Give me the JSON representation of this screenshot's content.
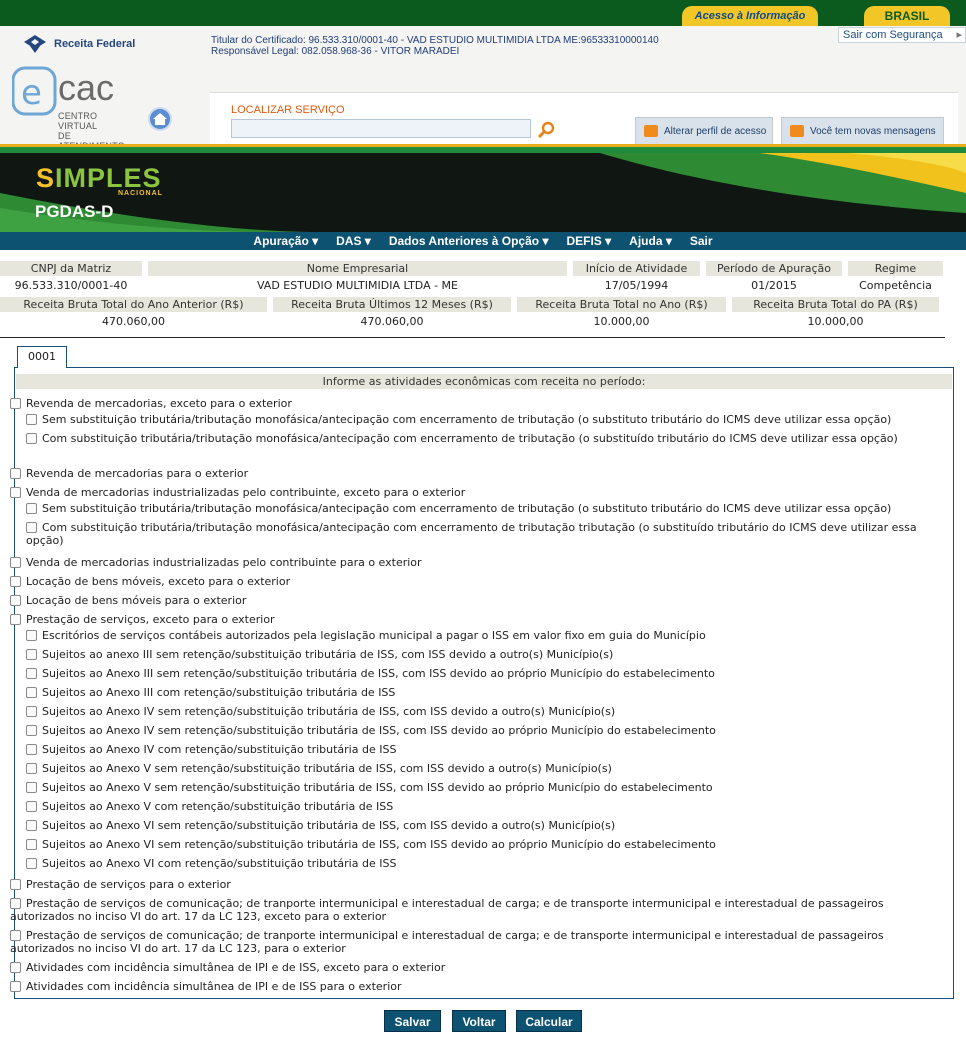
{
  "gov_bar": {
    "acesso": "Acesso à Informação",
    "brasil": "BRASIL"
  },
  "header": {
    "receita": "Receita Federal",
    "titular": "Titular do Certificado: 96.533.310/0001-40 - VAD ESTUDIO MULTIMIDIA LTDA ME:96533310000140",
    "responsavel": "Responsável Legal: 082.058.968-36 - VITOR MARADEI",
    "sair": "Sair com Segurança",
    "ecac": "cac",
    "ecac_sub1": "CENTRO VIRTUAL",
    "ecac_sub2": "DE ATENDIMENTO",
    "search_label": "LOCALIZAR SERVIÇO",
    "search_value": "",
    "perfil": "Alterar perfil de acesso",
    "mensagens": "Você tem novas mensagens"
  },
  "banner": {
    "logo_s": "S",
    "logo_rest": "IMPLES",
    "nacional": "NACIONAL",
    "title": "PGDAS-D"
  },
  "nav": [
    "Apuração ▾",
    "DAS ▾",
    "Dados Anteriores à Opção ▾",
    "DEFIS ▾",
    "Ajuda ▾",
    "Sair"
  ],
  "info": {
    "row1_headers": [
      "CNPJ da Matriz",
      "Nome Empresarial",
      "Início de Atividade",
      "Período de Apuração",
      "Regime"
    ],
    "row1_values": [
      "96.533.310/0001-40",
      "VAD ESTUDIO MULTIMIDIA LTDA - ME",
      "17/05/1994",
      "01/2015",
      "Competência"
    ],
    "row2_headers": [
      "Receita Bruta Total do Ano Anterior (R$)",
      "Receita Bruta Últimos 12 Meses (R$)",
      "Receita Bruta Total no Ano (R$)",
      "Receita Bruta Total do PA (R$)"
    ],
    "row2_values": [
      "470.060,00",
      "470.060,00",
      "10.000,00",
      "10.000,00"
    ]
  },
  "tab": "0001",
  "panel_title": "Informe as atividades econômicas com receita no período:",
  "activities": [
    "Revenda de mercadorias, exceto para o exterior",
    "Sem substituição tributária/tributação monofásica/antecipação com encerramento de tributação (o substituto tributário do ICMS deve utilizar essa opção)",
    "Com substituição tributária/tributação monofásica/antecipação com encerramento de tributação (o substituído tributário do ICMS deve utilizar essa opção)",
    "Revenda de mercadorias para o exterior",
    "Venda de mercadorias industrializadas pelo contribuinte, exceto para o exterior",
    "Sem substituição tributária/tributação monofásica/antecipação com encerramento de tributação (o substituto tributário do ICMS deve utilizar essa opção)",
    "Com substituição tributária/tributação monofásica/antecipação com encerramento de tributação tributação (o substituído tributário do ICMS deve utilizar essa opção)",
    "Venda de mercadorias industrializadas pelo contribuinte para o exterior",
    "Locação de bens móveis, exceto para o exterior",
    "Locação de bens móveis para o exterior",
    "Prestação de serviços, exceto para o exterior",
    "Escritórios de serviços contábeis autorizados pela legislação municipal a pagar o ISS em valor fixo em guia do Município",
    "Sujeitos ao anexo III sem retenção/substituição tributária de ISS, com ISS devido a outro(s) Município(s)",
    "Sujeitos ao Anexo III sem retenção/substituição tributária de ISS, com ISS devido ao próprio Município do estabelecimento",
    "Sujeitos ao Anexo III com retenção/substituição tributária de ISS",
    "Sujeitos ao Anexo IV sem retenção/substituição tributária de ISS, com ISS devido a outro(s) Município(s)",
    "Sujeitos ao Anexo IV sem retenção/substituição tributária de ISS, com ISS devido ao próprio Município do estabelecimento",
    "Sujeitos ao Anexo IV com retenção/substituição tributária de ISS",
    "Sujeitos ao Anexo V sem retenção/substituição tributária de ISS, com ISS devido a outro(s) Município(s)",
    "Sujeitos ao Anexo V sem retenção/substituição tributária de ISS, com ISS devido ao próprio Município do estabelecimento",
    "Sujeitos ao Anexo V com retenção/substituição tributária de ISS",
    "Sujeitos ao Anexo VI sem retenção/substituição tributária de ISS, com ISS devido a outro(s) Município(s)",
    "Sujeitos ao Anexo VI sem retenção/substituição tributária de ISS, com ISS devido ao próprio Município do estabelecimento",
    "Sujeitos ao Anexo VI com retenção/substituição tributária de ISS",
    "Prestação de serviços para o exterior",
    "Prestação de serviços de comunicação; de tranporte intermunicipal e interestadual de carga; e de transporte intermunicipal e interestadual de passageiros autorizados no inciso VI do art. 17 da LC 123, exceto para o exterior",
    "Prestação de serviços de comunicação; de tranporte intermunicipal e interestadual de carga; e de transporte intermunicipal e interestadual de passageiros autorizados no inciso VI do art. 17 da LC 123, para o exterior",
    "Atividades com incidência simultânea de IPI e de ISS, exceto para o exterior",
    "Atividades com incidência simultânea de IPI e de ISS para o exterior"
  ],
  "buttons": {
    "salvar": "Salvar",
    "voltar": "Voltar",
    "calcular": "Calcular"
  },
  "colors": {
    "gov_green": "#0b5b1f",
    "nav_blue": "#0d5270",
    "gold": "#f3c627",
    "simples_green": "#8bc53f"
  }
}
